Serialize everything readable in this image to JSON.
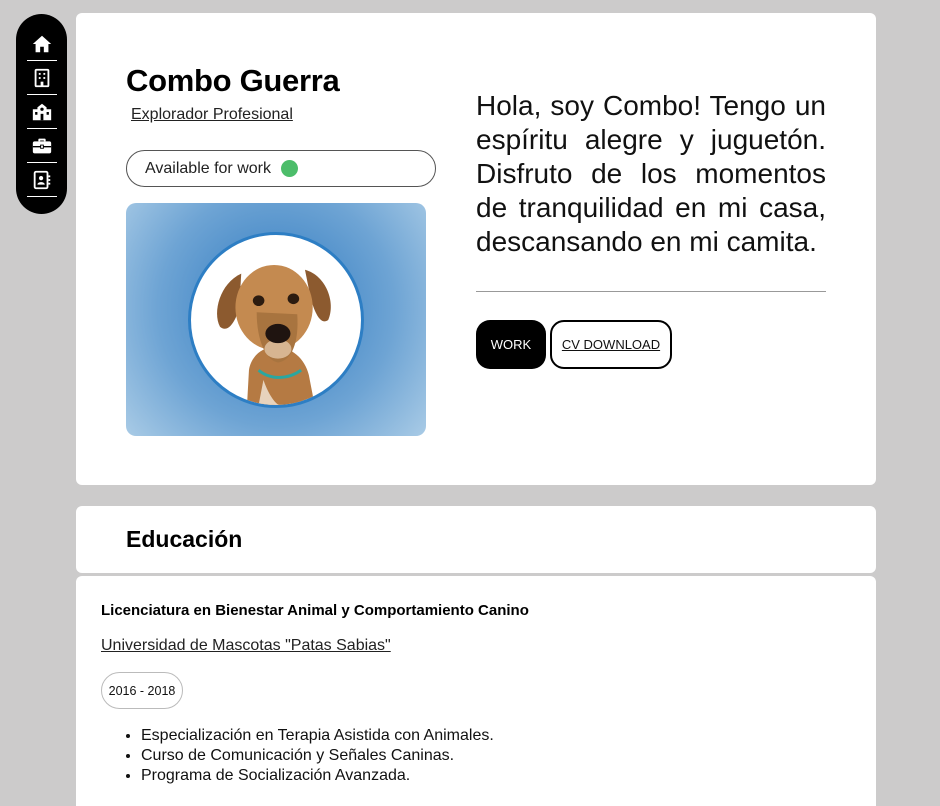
{
  "sidebar": {
    "items": [
      {
        "icon": "home-icon"
      },
      {
        "icon": "building-icon"
      },
      {
        "icon": "school-icon"
      },
      {
        "icon": "briefcase-icon"
      },
      {
        "icon": "contact-book-icon"
      }
    ]
  },
  "profile": {
    "name": "Combo Guerra",
    "role": "Explorador Profesional",
    "availability": "Available for work",
    "availability_color": "#4cbd6a",
    "bio": "Hola, soy Combo! Tengo un espíritu alegre y juguetón. Disfruto de los momentos de tranquilidad en mi casa, descansando en mi camita.",
    "buttons": {
      "work": "WORK",
      "cv": "CV DOWNLOAD"
    }
  },
  "education": {
    "title": "Educación",
    "entries": [
      {
        "degree": "Licenciatura en Bienestar Animal y Comportamiento Canino",
        "school": "Universidad de Mascotas \"Patas Sabias\"",
        "years": "2016 - 2018",
        "items": [
          "Especialización en Terapia Asistida con Animales.",
          "Curso de Comunicación y Señales Caninas.",
          "Programa de Socialización Avanzada."
        ]
      }
    ]
  },
  "colors": {
    "background": "#cccbcb",
    "accent_blue": "#2d7ec4",
    "sidebar": "#000000"
  }
}
